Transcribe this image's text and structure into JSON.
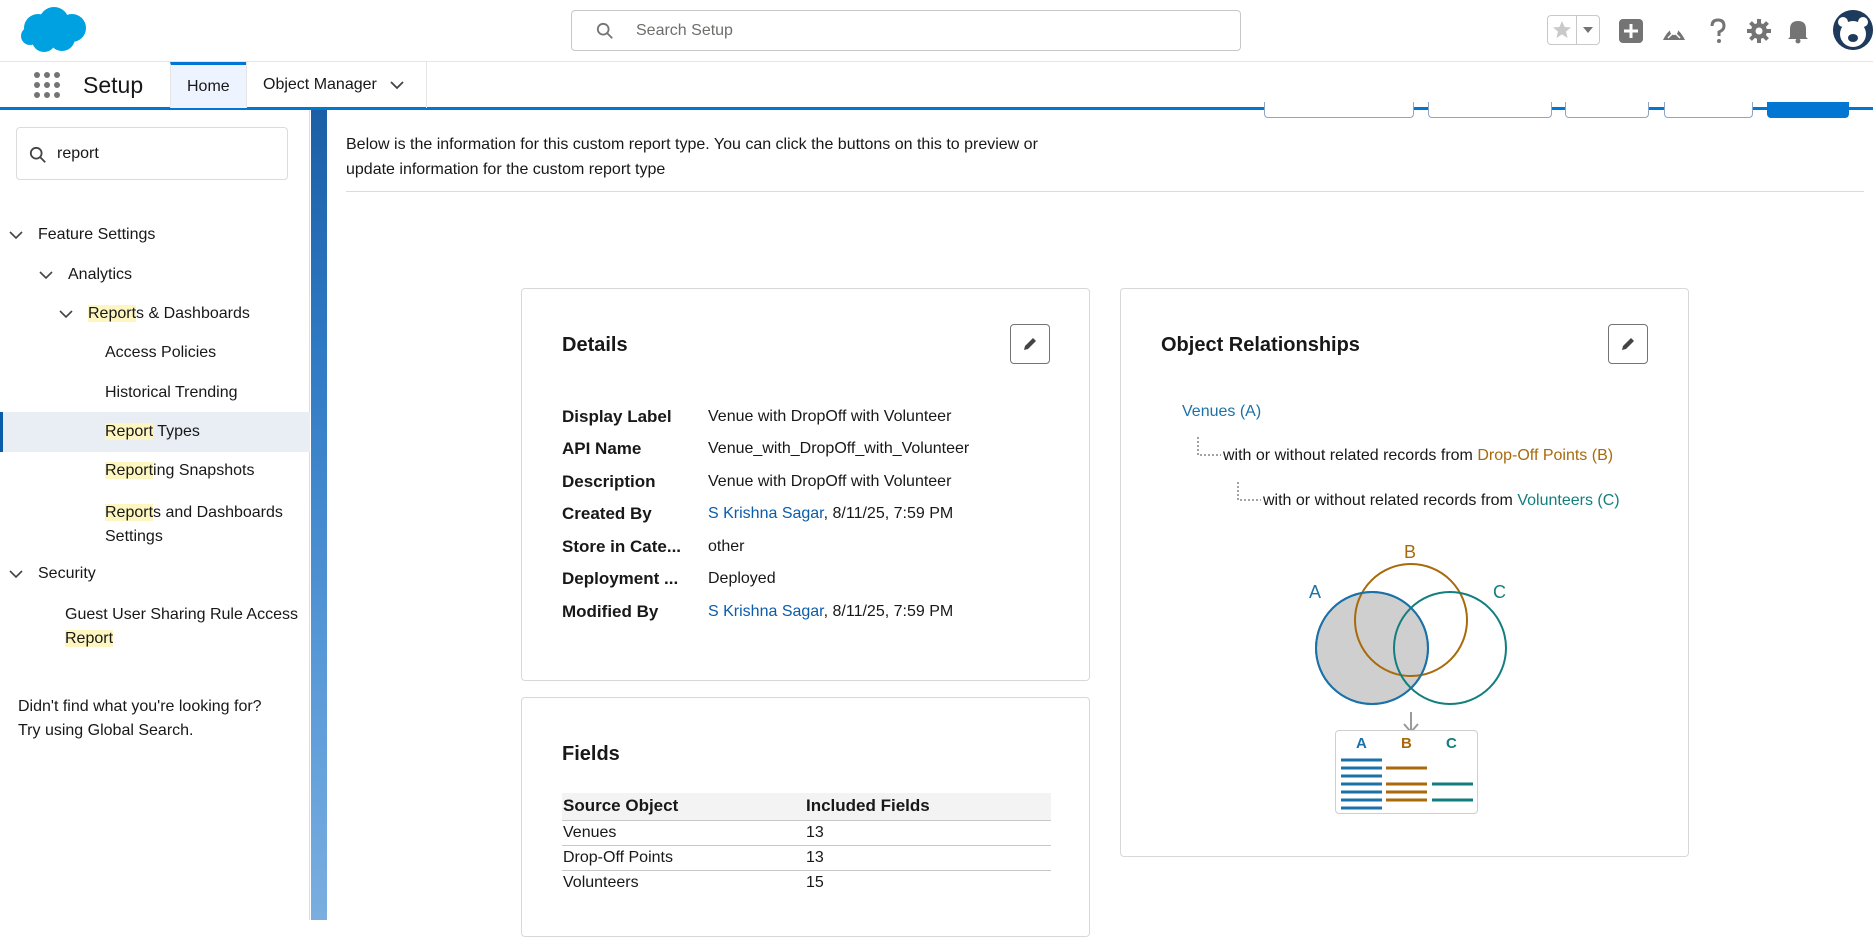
{
  "header": {
    "search_placeholder": "Search Setup",
    "brand_color": "#00a1e0"
  },
  "context": {
    "app_name": "Setup",
    "tabs": [
      {
        "label": "Home"
      },
      {
        "label": "Object Manager"
      }
    ]
  },
  "sidebar": {
    "quickfind_value": "report",
    "items": {
      "feature_settings": "Feature Settings",
      "analytics": "Analytics",
      "reports_dashboards_hl": "Report",
      "reports_dashboards_rest": "s & Dashboards",
      "access_policies": "Access Policies",
      "historical_trending": "Historical Trending",
      "report_types_hl": "Report",
      "report_types_rest": " Types",
      "reporting_snapshots_hl": "Report",
      "reporting_snapshots_rest": "ing Snapshots",
      "rd_settings_hl": "Report",
      "rd_settings_rest": "s and Dashboards",
      "rd_settings_line2": "Settings",
      "security": "Security",
      "guest_line1": "Guest User Sharing Rule Access",
      "guest_line2_hl": "Report"
    },
    "help_line1": "Didn't find what you're looking for?",
    "help_line2": "Try using Global Search."
  },
  "main": {
    "intro_line1": "Below is the information for this custom report type. You can click the buttons on this to preview or",
    "intro_line2": "update information for the custom report type",
    "details": {
      "title": "Details",
      "rows": [
        {
          "label": "Display Label",
          "value": "Venue with DropOff with Volunteer"
        },
        {
          "label": "API Name",
          "value": "Venue_with_DropOff_with_Volunteer"
        },
        {
          "label": "Description",
          "value": "Venue with DropOff with Volunteer"
        },
        {
          "label": "Created By",
          "link": "S Krishna Sagar",
          "value": ", 8/11/25, 7:59 PM"
        },
        {
          "label": "Store in Cate...",
          "value": "other"
        },
        {
          "label": "Deployment ...",
          "value": "Deployed"
        },
        {
          "label": "Modified By",
          "link": "S Krishna Sagar",
          "value": ", 8/11/25, 7:59 PM"
        }
      ]
    },
    "fields": {
      "title": "Fields",
      "columns": [
        "Source Object",
        "Included Fields"
      ],
      "rows": [
        {
          "object": "Venues",
          "count": "13"
        },
        {
          "object": "Drop-Off Points",
          "count": "13"
        },
        {
          "object": "Volunteers",
          "count": "15"
        }
      ]
    },
    "relationships": {
      "title": "Object Relationships",
      "object_a": "Venues (A)",
      "rel_text": "with or without related records from",
      "object_b": "Drop-Off Points (B)",
      "object_c": "Volunteers (C)",
      "venn_labels": {
        "a": "A",
        "b": "B",
        "c": "C"
      },
      "colors": {
        "a": "#1b72a8",
        "b": "#a86a0b",
        "c": "#137e7e"
      }
    }
  }
}
